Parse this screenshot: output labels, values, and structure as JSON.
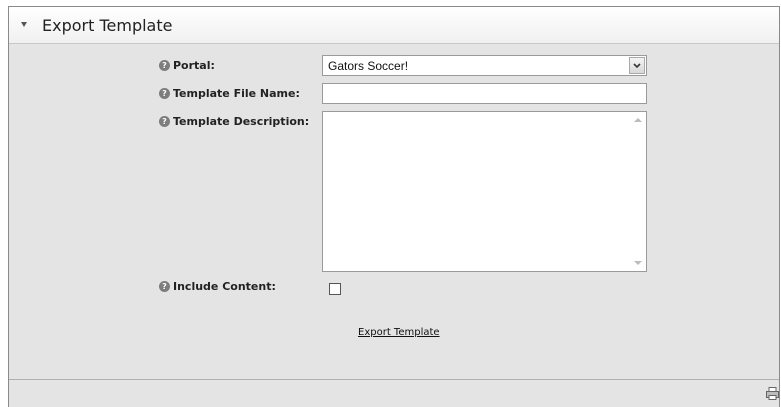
{
  "section": {
    "title": "Export Template"
  },
  "form": {
    "portal": {
      "label": "Portal:",
      "selected": "Gators Soccer!"
    },
    "template_file_name": {
      "label": "Template File Name:",
      "value": ""
    },
    "template_description": {
      "label": "Template Description:",
      "value": ""
    },
    "include_content": {
      "label": "Include Content:",
      "checked": false
    },
    "export_link": "Export Template"
  }
}
